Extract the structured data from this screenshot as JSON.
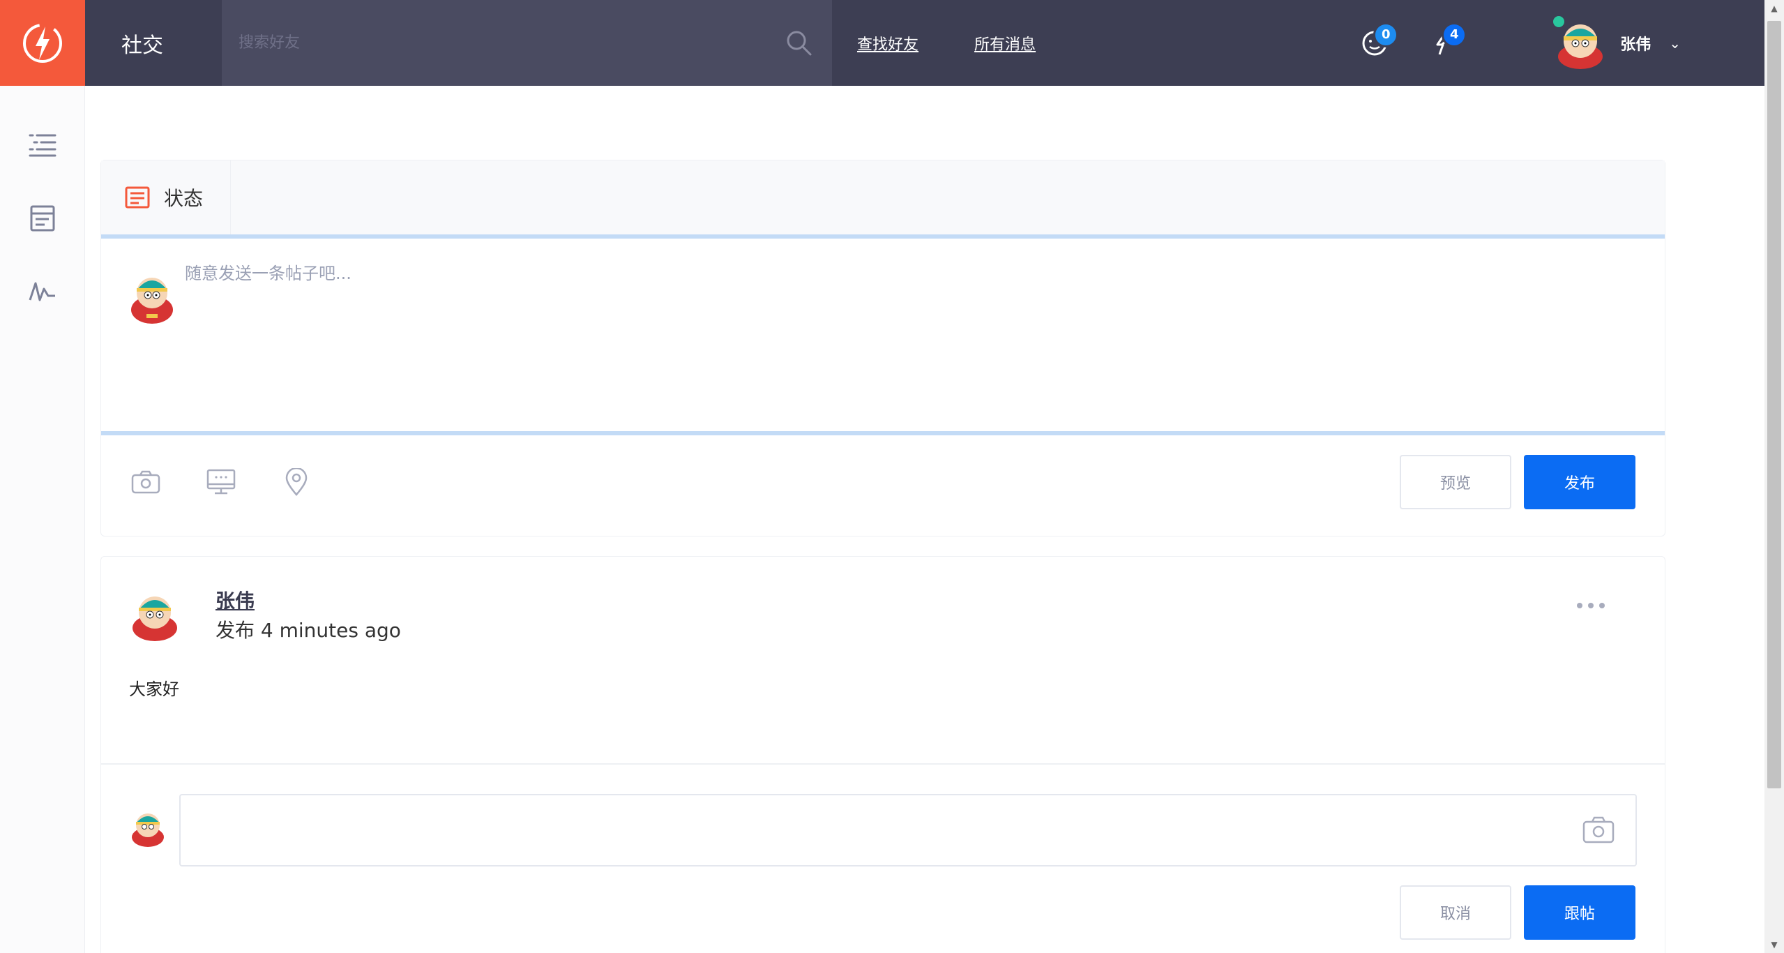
{
  "topbar": {
    "brand": "社交",
    "search_placeholder": "搜索好友",
    "links": [
      "查找好友",
      "所有消息"
    ],
    "messages_badge": "0",
    "notifications_badge": "4",
    "user_name": "张伟",
    "user_caret": "⌄"
  },
  "composer": {
    "tab_label": "状态",
    "placeholder": "随意发送一条帖子吧...",
    "preview_button": "预览",
    "publish_button": "发布"
  },
  "post": {
    "author": "张伟",
    "meta": "发布 4 minutes ago",
    "content": "大家好",
    "cancel_button": "取消",
    "reply_button": "跟帖"
  },
  "colors": {
    "accent": "#f4593b",
    "topbar": "#3d3e53",
    "primary": "#0b6cf3"
  }
}
